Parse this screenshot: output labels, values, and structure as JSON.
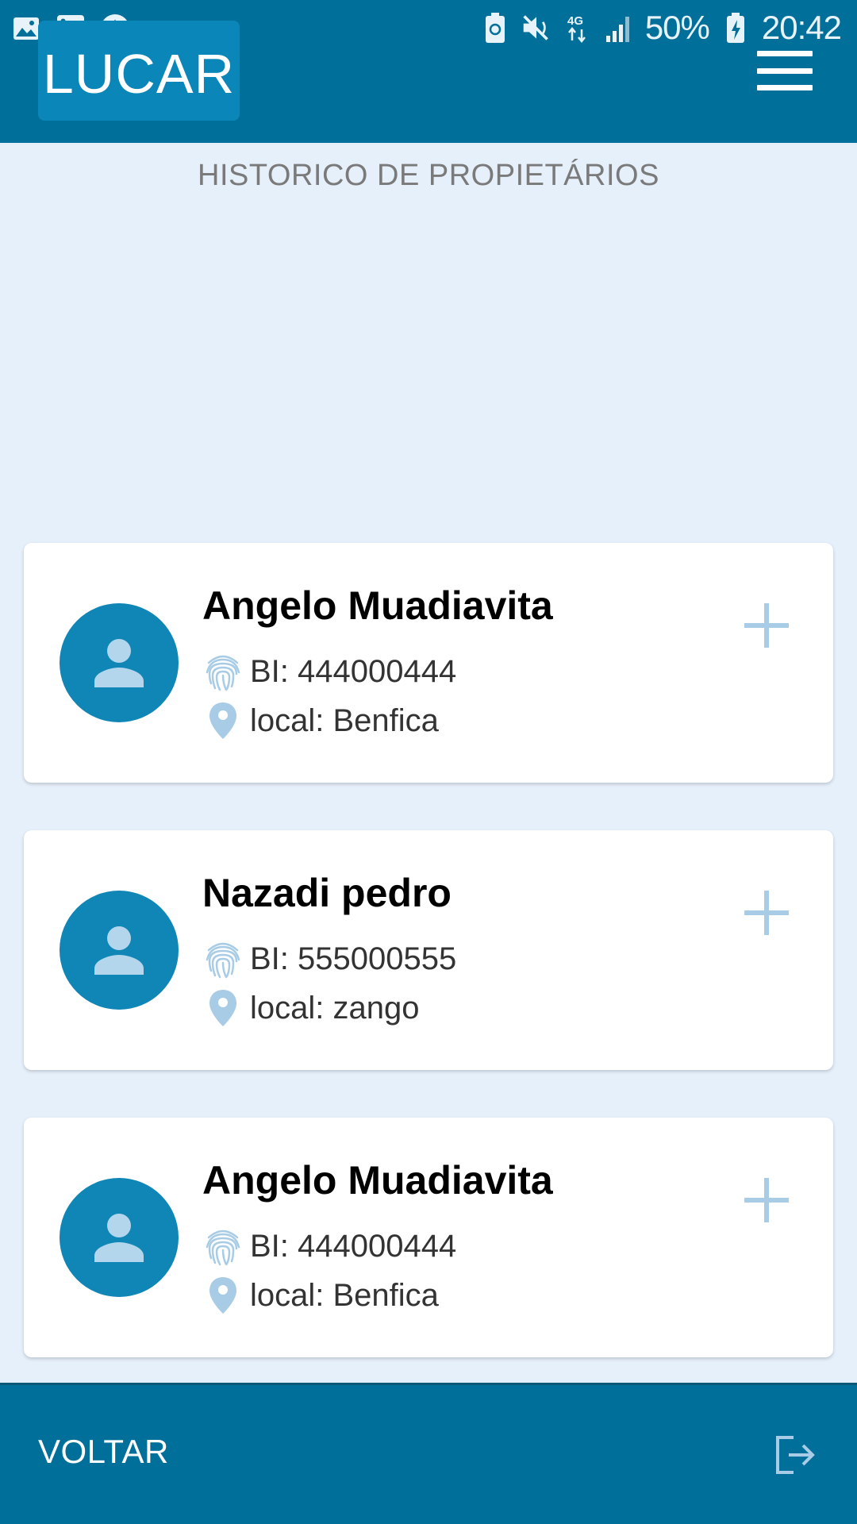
{
  "status_bar": {
    "battery": "50%",
    "time": "20:42",
    "network": "4G",
    "overflow": "···"
  },
  "header": {
    "logo": "LUCAR",
    "menu_icon": "hamburger-menu-icon"
  },
  "page": {
    "title": "HISTORICO DE PROPIETÁRIOS"
  },
  "owners": [
    {
      "name": "Angelo Muadiavita",
      "bi": "BI: 444000444",
      "local": "local: Benfica"
    },
    {
      "name": "Nazadi pedro",
      "bi": "BI: 555000555",
      "local": "local: zango"
    },
    {
      "name": "Angelo Muadiavita",
      "bi": "BI: 444000444",
      "local": "local: Benfica"
    }
  ],
  "footer": {
    "back_label": "VOLTAR",
    "exit_icon": "logout-icon"
  },
  "colors": {
    "primary": "#006f99",
    "avatar": "#0f86b6",
    "background": "#e6f0fb",
    "accent_light": "#a8cce6"
  }
}
